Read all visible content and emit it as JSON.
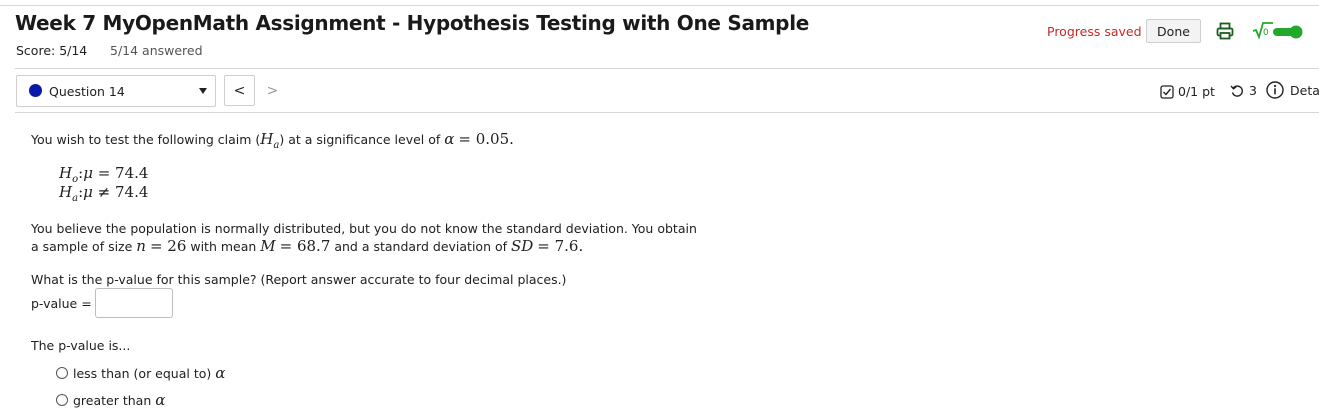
{
  "header": {
    "title": "Week 7 MyOpenMath Assignment - Hypothesis Testing with One Sample",
    "score": "Score: 5/14",
    "answered": "5/14 answered",
    "progress_saved": "Progress saved",
    "done_label": "Done"
  },
  "nav": {
    "question_selected": "Question 14",
    "prev_label": "<",
    "next_label": ">",
    "points": "0/1 pt",
    "tries": "3",
    "details_label": "Deta"
  },
  "question": {
    "intro_prefix": "You wish to test the following claim (",
    "intro_mid": ") at a significance level of ",
    "alpha_value": "= 0.05.",
    "h0_line": "= 74.4",
    "ha_line": "≠ 74.4",
    "para2_line1": "You believe the population is normally distributed, but you do not know the standard deviation. You obtain",
    "para2_prefix": "a sample of size ",
    "n_value": "= 26",
    "para2_mid": " with mean ",
    "m_value": "= 68.7",
    "para2_mid2": " and a standard deviation of ",
    "sd_value": "= 7.6.",
    "prompt": "What is the p-value for this sample? (Report answer accurate to four decimal places.)",
    "pvalue_label": "p-value =",
    "pvalue_value": "",
    "pvalue_is": "The p-value is...",
    "options": [
      "less than (or equal to) ",
      "greater than "
    ]
  },
  "colors": {
    "progress_saved": "#c62828",
    "question_dot": "#0a1aa8",
    "toggle_on": "#22a82b"
  }
}
